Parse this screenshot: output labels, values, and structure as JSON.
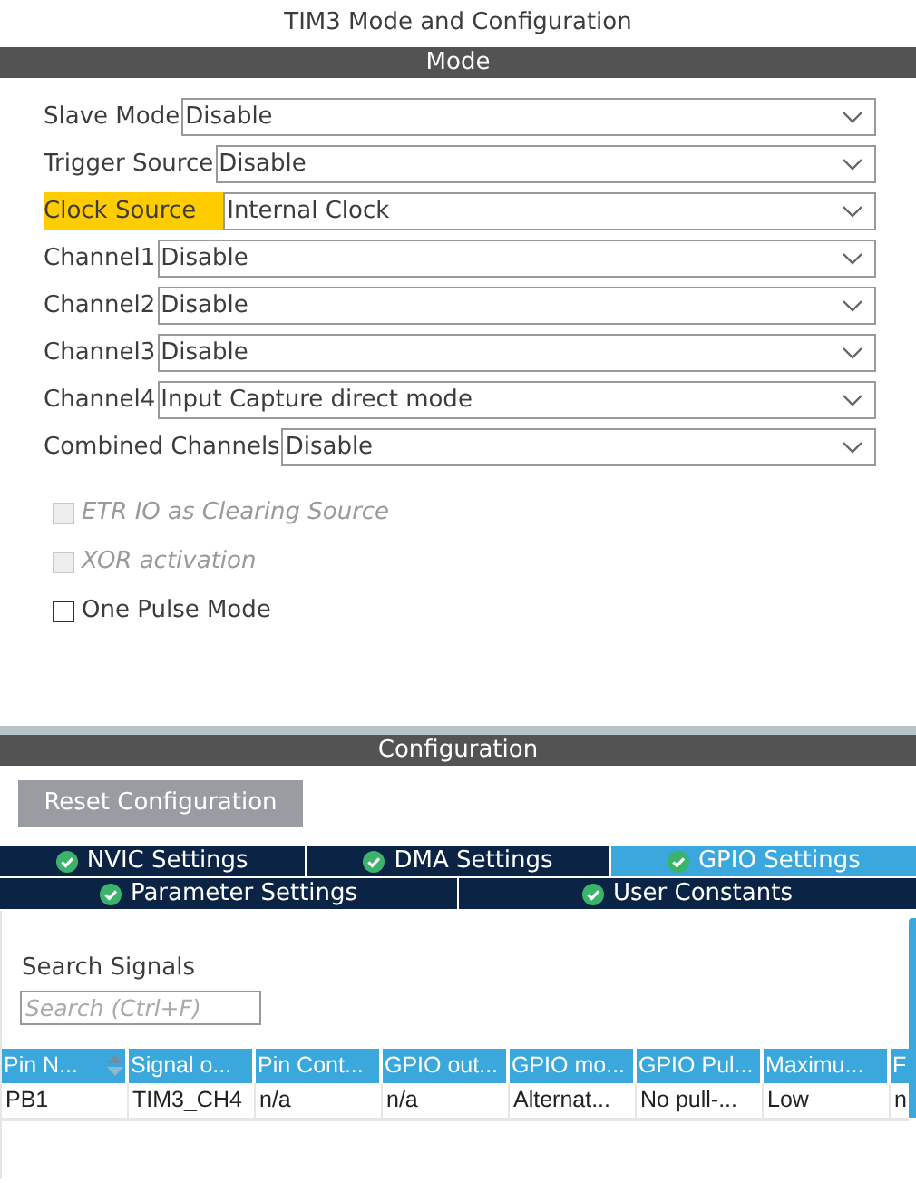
{
  "window": {
    "title": "TIM3 Mode and Configuration"
  },
  "mode": {
    "header": "Mode",
    "fields": [
      {
        "label": "Slave Mode",
        "value": "Disable",
        "highlighted": false
      },
      {
        "label": "Trigger Source",
        "value": "Disable",
        "highlighted": false
      },
      {
        "label": "Clock Source",
        "value": "Internal Clock",
        "highlighted": true
      },
      {
        "label": "Channel1",
        "value": "Disable",
        "highlighted": false
      },
      {
        "label": "Channel2",
        "value": "Disable",
        "highlighted": false
      },
      {
        "label": "Channel3",
        "value": "Disable",
        "highlighted": false
      },
      {
        "label": "Channel4",
        "value": "Input Capture direct mode",
        "highlighted": false
      },
      {
        "label": "Combined Channels",
        "value": "Disable",
        "highlighted": false
      }
    ],
    "checkboxes": [
      {
        "label": "ETR IO as Clearing Source",
        "checked": false,
        "disabled": true
      },
      {
        "label": "XOR activation",
        "checked": false,
        "disabled": true
      },
      {
        "label": "One Pulse Mode",
        "checked": false,
        "disabled": false
      }
    ]
  },
  "configuration": {
    "header": "Configuration",
    "reset_button": "Reset Configuration",
    "tab_rows": [
      {
        "tabs": [
          {
            "label": "NVIC Settings",
            "selected": false
          },
          {
            "label": "DMA Settings",
            "selected": false
          },
          {
            "label": "GPIO Settings",
            "selected": true
          }
        ]
      },
      {
        "tabs": [
          {
            "label": "Parameter Settings",
            "selected": false
          },
          {
            "label": "User Constants",
            "selected": false
          }
        ]
      }
    ],
    "search": {
      "label": "Search Signals",
      "placeholder": "Search (Ctrl+F)"
    },
    "table": {
      "columns": [
        {
          "label": "Pin N...",
          "sortable": true
        },
        {
          "label": "Signal o...",
          "sortable": false
        },
        {
          "label": "Pin Cont...",
          "sortable": false
        },
        {
          "label": "GPIO out...",
          "sortable": false
        },
        {
          "label": "GPIO mo...",
          "sortable": false
        },
        {
          "label": "GPIO Pul...",
          "sortable": false
        },
        {
          "label": "Maximu...",
          "sortable": false
        },
        {
          "label": "F",
          "sortable": false
        }
      ],
      "rows": [
        [
          "PB1",
          "TIM3_CH4",
          "n/a",
          "n/a",
          "Alternat...",
          "No pull-...",
          "Low",
          "n"
        ]
      ]
    }
  }
}
